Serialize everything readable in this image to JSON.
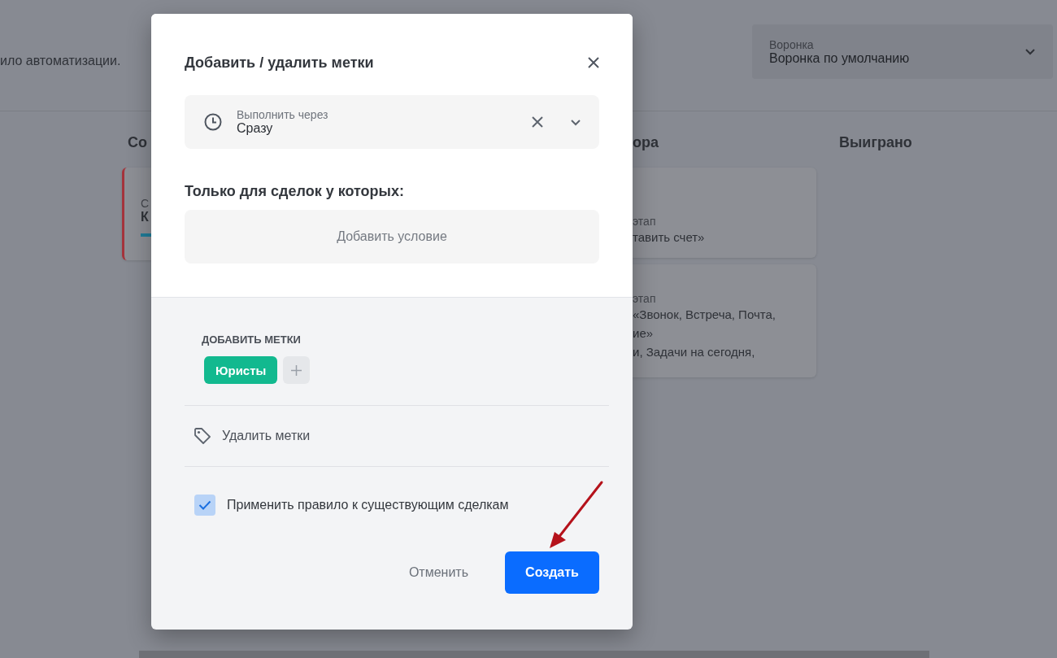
{
  "background": {
    "description_fragment": "ило автоматизации.",
    "funnel": {
      "label": "Воронка",
      "value": "Воронка по умолчанию"
    },
    "columns": [
      {
        "title": "Со",
        "cards": [
          {
            "label": "С",
            "value": "К"
          }
        ]
      },
      {
        "title": "ора",
        "cards": [
          {
            "label": "этап",
            "lines": [
              "тавить счет»"
            ]
          },
          {
            "label": "этап",
            "lines": [
              "«Звонок, Встреча, Почта,",
              "ие»",
              "и, Задачи на сегодня,"
            ]
          }
        ]
      },
      {
        "title": "Выиграно"
      }
    ]
  },
  "modal": {
    "title": "Добавить / удалить метки",
    "delay": {
      "label": "Выполнить через",
      "value": "Сразу"
    },
    "conditions": {
      "heading": "Только для сделок у которых:",
      "add_button": "Добавить условие"
    },
    "add_tags": {
      "heading": "ДОБАВИТЬ МЕТКИ",
      "tags": [
        {
          "label": "Юристы",
          "color": "#12b98f"
        }
      ]
    },
    "remove_tags": {
      "label": "Удалить метки"
    },
    "apply_existing": {
      "label": "Применить правило к существующим сделкам",
      "checked": true
    },
    "buttons": [
      {
        "label": "Отменить",
        "kind": "secondary"
      },
      {
        "label": "Создать",
        "kind": "primary"
      }
    ]
  }
}
